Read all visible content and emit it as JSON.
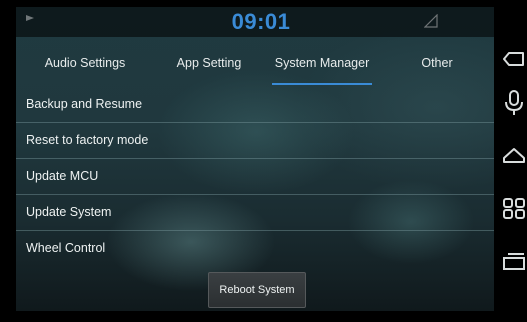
{
  "status": {
    "clock": "09:01",
    "left_icon": "play-indicator-icon",
    "right_icon": "signal-icon"
  },
  "tabs": [
    {
      "label": "Audio Settings"
    },
    {
      "label": "App Setting"
    },
    {
      "label": "System Manager",
      "active": true
    },
    {
      "label": "Other"
    }
  ],
  "menu": [
    {
      "label": "Backup and Resume"
    },
    {
      "label": "Reset to factory mode"
    },
    {
      "label": "Update MCU"
    },
    {
      "label": "Update System"
    },
    {
      "label": "Wheel Control"
    }
  ],
  "reboot_label": "Reboot System",
  "sidebar_icons": [
    "back-icon",
    "microphone-icon",
    "home-icon",
    "apps-grid-icon",
    "recent-apps-icon"
  ],
  "colors": {
    "accent": "#3a8bd6",
    "text": "#eef2f2"
  }
}
